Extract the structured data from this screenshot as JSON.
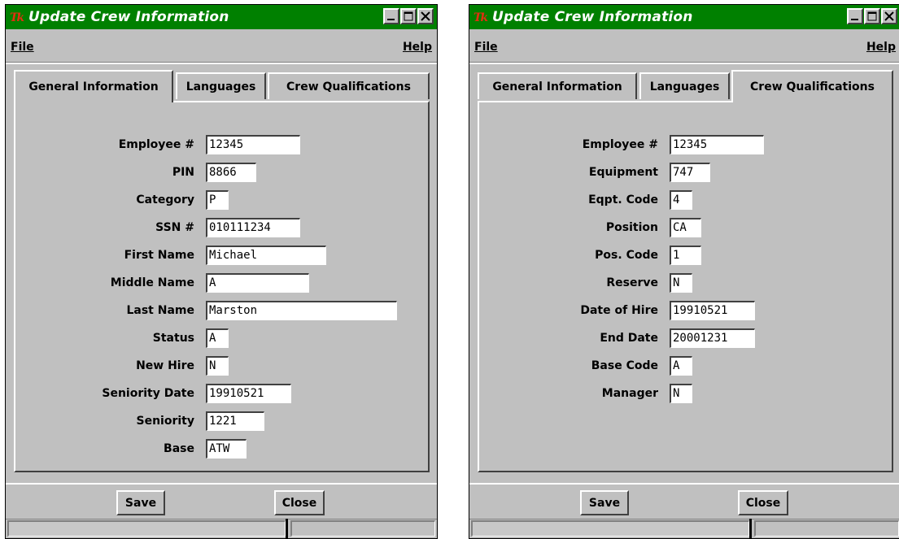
{
  "window_title": "Update Crew Information",
  "menu": {
    "file": "File",
    "help": "Help"
  },
  "tabs": {
    "general": "General Information",
    "languages": "Languages",
    "qualifications": "Crew Qualifications"
  },
  "buttons": {
    "save": "Save",
    "close": "Close"
  },
  "general_fields": [
    {
      "label": "Employee #",
      "value": "12345"
    },
    {
      "label": "PIN",
      "value": "8866"
    },
    {
      "label": "Category",
      "value": "P"
    },
    {
      "label": "SSN #",
      "value": "010111234"
    },
    {
      "label": "First Name",
      "value": "Michael"
    },
    {
      "label": "Middle Name",
      "value": "A"
    },
    {
      "label": "Last Name",
      "value": "Marston"
    },
    {
      "label": "Status",
      "value": "A"
    },
    {
      "label": "New Hire",
      "value": "N"
    },
    {
      "label": "Seniority Date",
      "value": "19910521"
    },
    {
      "label": "Seniority",
      "value": "1221"
    },
    {
      "label": "Base",
      "value": "ATW"
    }
  ],
  "qualification_fields": [
    {
      "label": "Employee #",
      "value": "12345"
    },
    {
      "label": "Equipment",
      "value": "747"
    },
    {
      "label": "Eqpt. Code",
      "value": "4"
    },
    {
      "label": "Position",
      "value": "CA"
    },
    {
      "label": "Pos. Code",
      "value": "1"
    },
    {
      "label": "Reserve",
      "value": "N"
    },
    {
      "label": "Date of Hire",
      "value": "19910521"
    },
    {
      "label": "End Date",
      "value": "20001231"
    },
    {
      "label": "Base Code",
      "value": "A"
    },
    {
      "label": "Manager",
      "value": "N"
    }
  ],
  "colors": {
    "titlebar": "#008000",
    "window_bg": "#c0c0c0",
    "logo": "#d02010"
  },
  "icons": [
    "tk-logo-icon",
    "minimize-icon",
    "maximize-icon",
    "close-icon"
  ]
}
